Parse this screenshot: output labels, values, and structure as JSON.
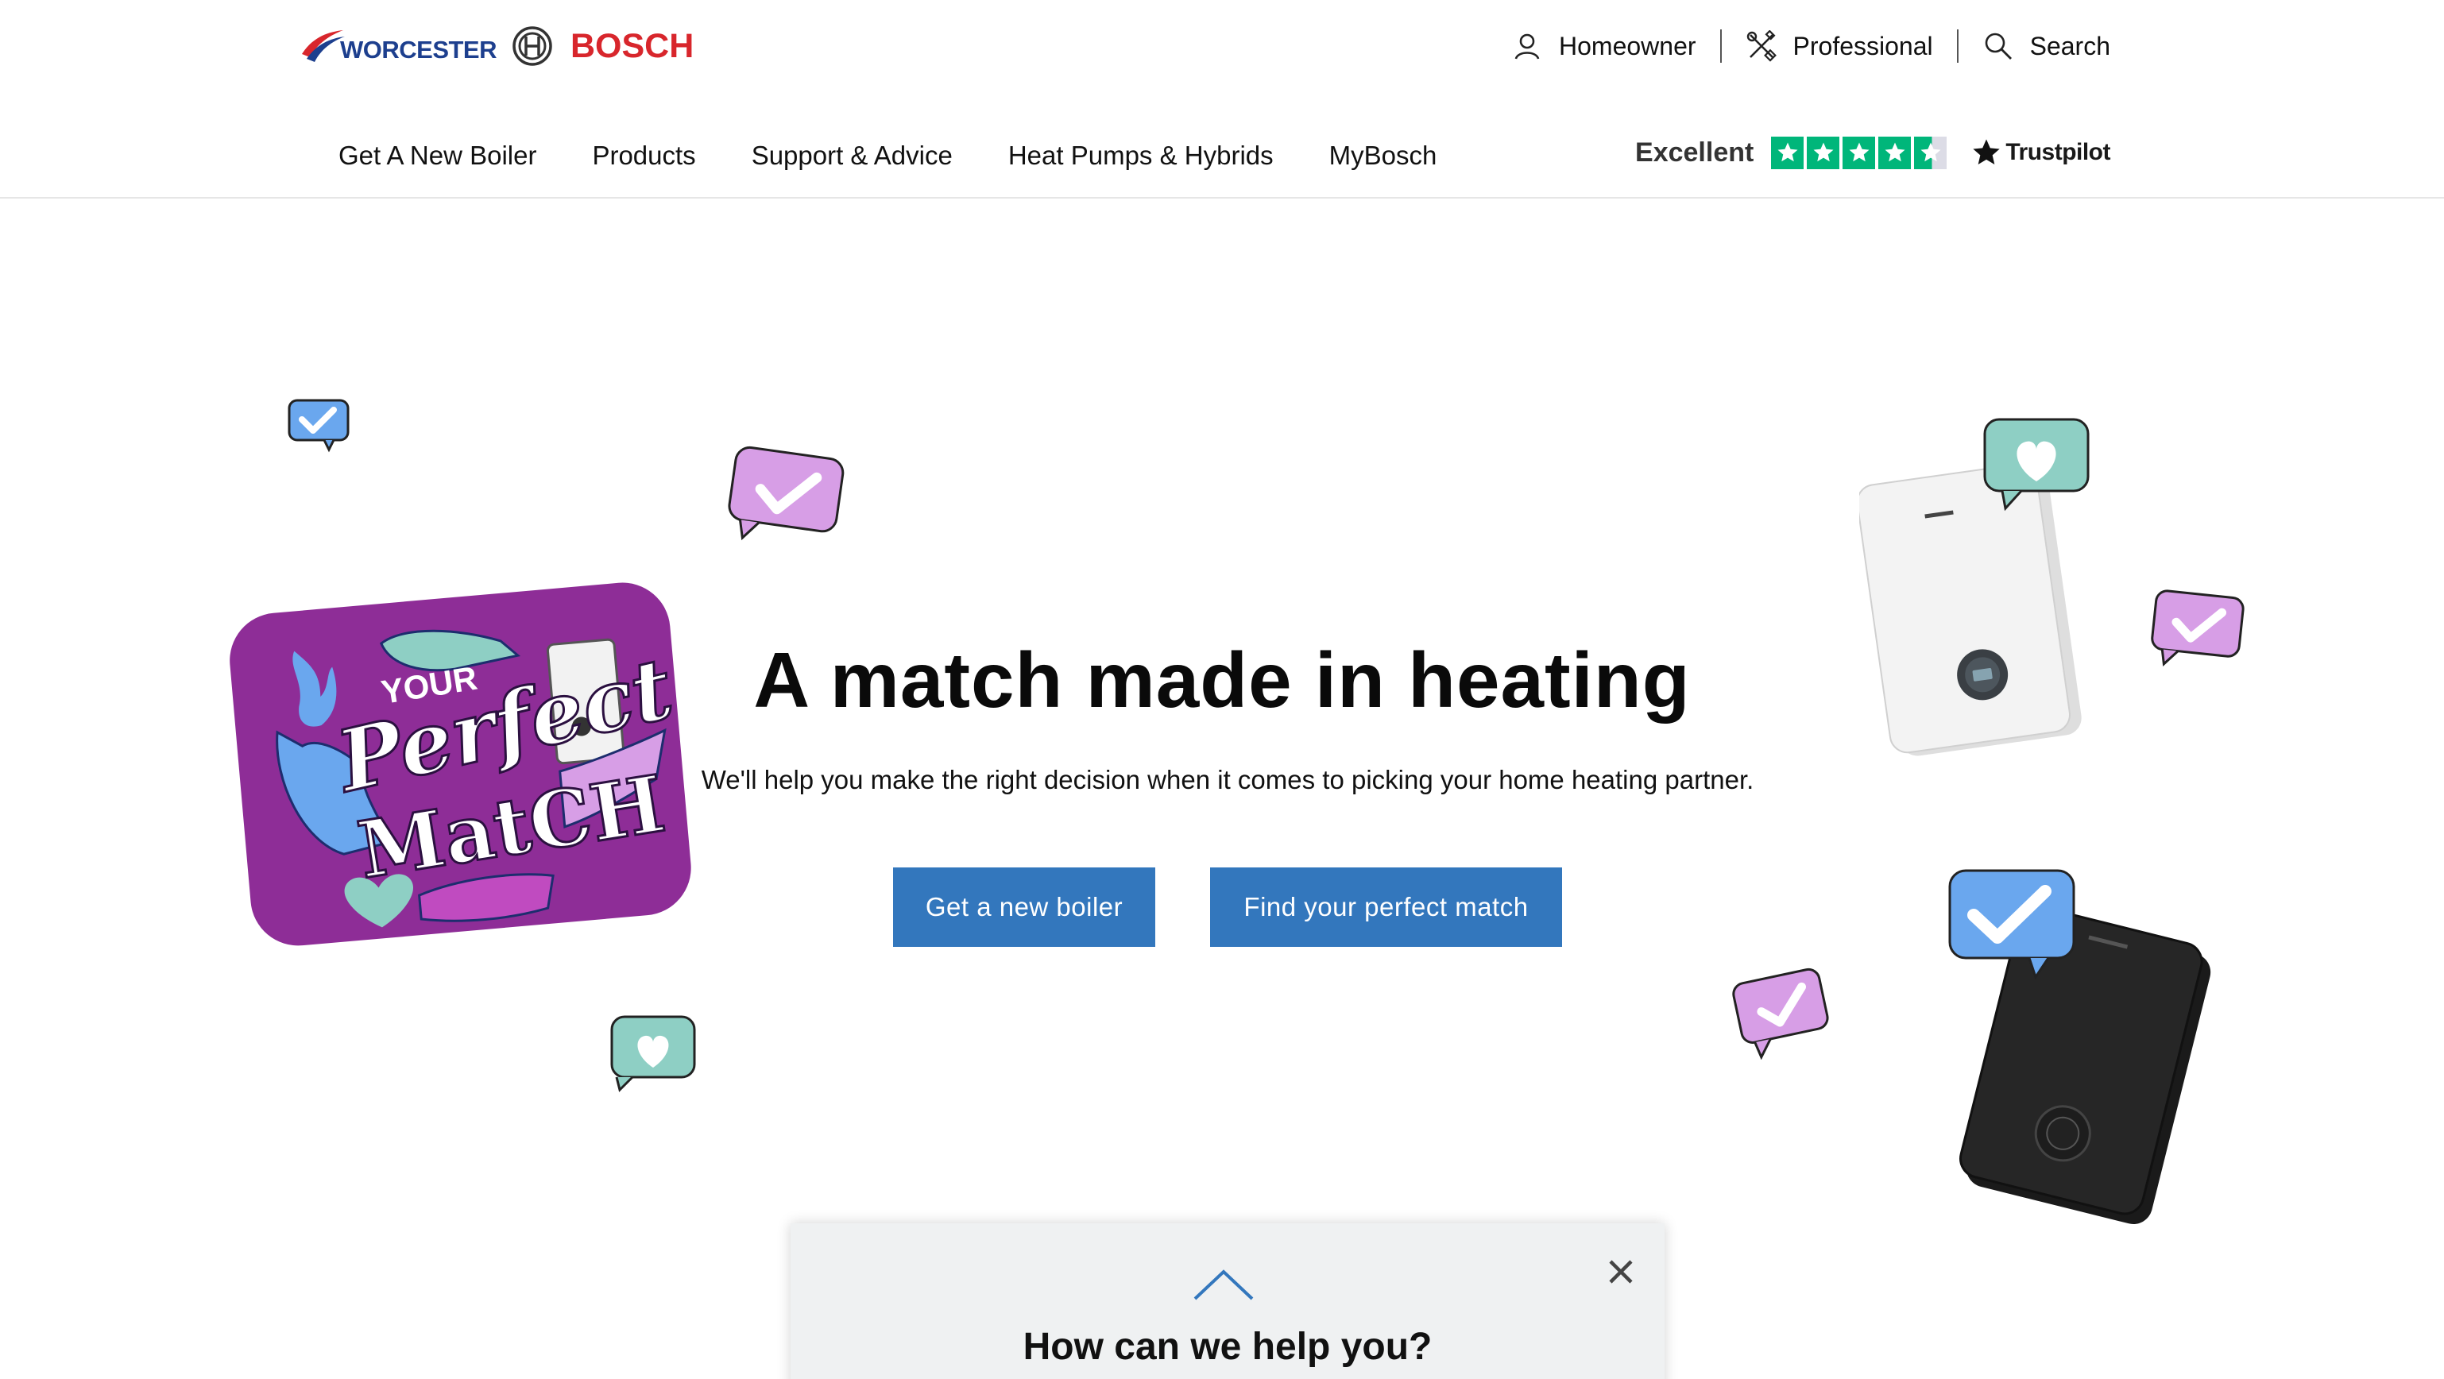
{
  "brand": {
    "worcester": "WORCESTER",
    "bosch": "BOSCH"
  },
  "utility_nav": [
    {
      "label": "Homeowner",
      "icon": "user-icon"
    },
    {
      "label": "Professional",
      "icon": "tools-icon"
    },
    {
      "label": "Search",
      "icon": "search-icon"
    }
  ],
  "main_nav": [
    {
      "label": "Get A New Boiler"
    },
    {
      "label": "Products"
    },
    {
      "label": "Support & Advice"
    },
    {
      "label": "Heat Pumps & Hybrids"
    },
    {
      "label": "MyBosch"
    }
  ],
  "trustpilot": {
    "rating_label": "Excellent",
    "brand": "Trustpilot",
    "stars": 4.5
  },
  "hero": {
    "title": "A match made in heating",
    "subtitle": "We'll help you make the right decision when it comes to picking your home heating partner.",
    "primary_button": "Get a new boiler",
    "secondary_button": "Find your perfect match"
  },
  "promo_card": {
    "line1": "YOUR",
    "line2": "Perfect",
    "line3": "MatCH"
  },
  "help_panel": {
    "title": "How can we help you?"
  },
  "colors": {
    "brand_blue": "#3377bd",
    "bosch_red": "#d8262c",
    "worcester_blue": "#1d3f8e",
    "trustpilot_green": "#00b67a",
    "card_purple": "#8e2d97",
    "bubble_blue": "#6aa7ee",
    "bubble_pink": "#d79ee6",
    "bubble_teal": "#8ecfc4"
  }
}
